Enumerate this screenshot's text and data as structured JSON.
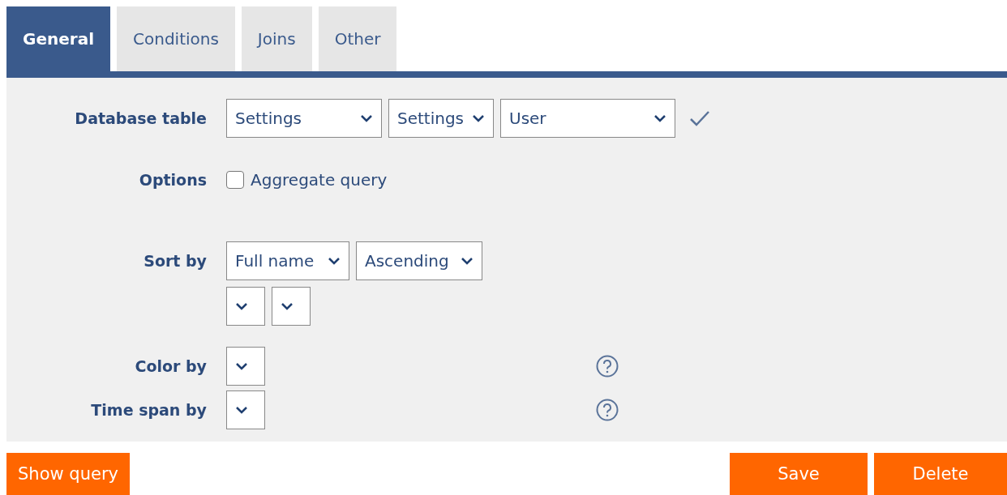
{
  "tabs": [
    {
      "label": "General",
      "selected": true
    },
    {
      "label": "Conditions",
      "selected": false
    },
    {
      "label": "Joins",
      "selected": false
    },
    {
      "label": "Other",
      "selected": false
    }
  ],
  "form": [
    {
      "kind": "selects",
      "label": "Database table",
      "lines": [
        [
          {
            "value": "Settings"
          },
          {
            "value": "Settings"
          },
          {
            "value": "User"
          }
        ]
      ],
      "confirmed": true
    },
    {
      "kind": "checkbox",
      "label": "Options",
      "checkbox": {
        "label": "Aggregate query",
        "checked": false
      }
    },
    {
      "kind": "selects",
      "label": "Sort by",
      "lines": [
        [
          {
            "value": "Full name"
          },
          {
            "value": "Ascending"
          }
        ],
        [
          {
            "empty": true
          },
          {
            "empty": true
          }
        ]
      ]
    },
    {
      "kind": "selects",
      "label": "Color by",
      "lines": [
        [
          {
            "empty": true
          }
        ]
      ],
      "help": true
    },
    {
      "kind": "selects",
      "label": "Time span by",
      "lines": [
        [
          {
            "empty": true
          }
        ]
      ],
      "help": true
    }
  ],
  "buttons_left": [
    "Show query"
  ],
  "buttons_right": [
    "Save",
    "Delete"
  ]
}
